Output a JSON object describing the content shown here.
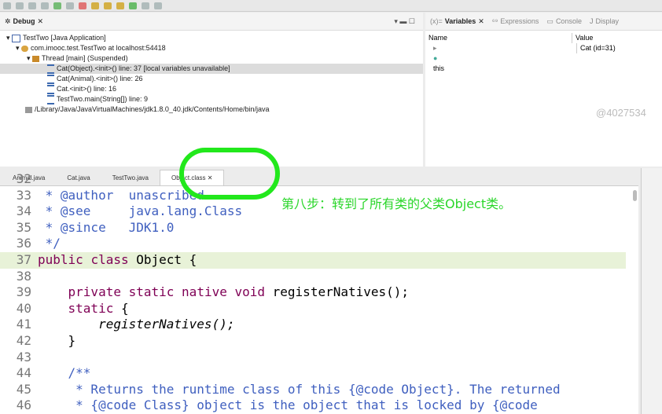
{
  "debug": {
    "title": "Debug",
    "tree": [
      "TestTwo [Java Application]",
      "com.imooc.test.TestTwo at localhost:54418",
      "Thread [main] (Suspended)",
      "Cat(Object).<init>() line: 37 [local variables unavailable]",
      "Cat(Animal).<init>() line: 26",
      "Cat.<init>() line: 16",
      "TestTwo.main(String[]) line: 9",
      "/Library/Java/JavaVirtualMachines/jdk1.8.0_40.jdk/Contents/Home/bin/java"
    ]
  },
  "variables": {
    "tabs": [
      "Variables",
      "Expressions",
      "Console",
      "Display"
    ],
    "col_name": "Name",
    "col_value": "Value",
    "rows": [
      {
        "name": "this",
        "value": "Cat  (id=31)"
      }
    ]
  },
  "watermark": "@4027534",
  "editor": {
    "tabs": [
      "Animal.java",
      "Cat.java",
      "TestTwo.java",
      "Object.class"
    ],
    "lines": [
      {
        "n": "32",
        "t": ""
      },
      {
        "n": "33",
        "t": " * @author  unascribed"
      },
      {
        "n": "34",
        "t": " * @see     java.lang.Class"
      },
      {
        "n": "35",
        "t": " * @since   JDK1.0"
      },
      {
        "n": "36",
        "t": " */"
      },
      {
        "n": "37",
        "t": "public class Object {"
      },
      {
        "n": "38",
        "t": ""
      },
      {
        "n": "39",
        "t": "    private static native void registerNatives();"
      },
      {
        "n": "40",
        "t": "    static {"
      },
      {
        "n": "41",
        "t": "        registerNatives();"
      },
      {
        "n": "42",
        "t": "    }"
      },
      {
        "n": "43",
        "t": ""
      },
      {
        "n": "44",
        "t": "    /**"
      },
      {
        "n": "45",
        "t": "     * Returns the runtime class of this {@code Object}. The returned"
      },
      {
        "n": "46",
        "t": "     * {@code Class} object is the object that is locked by {@code"
      }
    ]
  },
  "annotation": "第八步：转到了所有类的父类Object类。"
}
